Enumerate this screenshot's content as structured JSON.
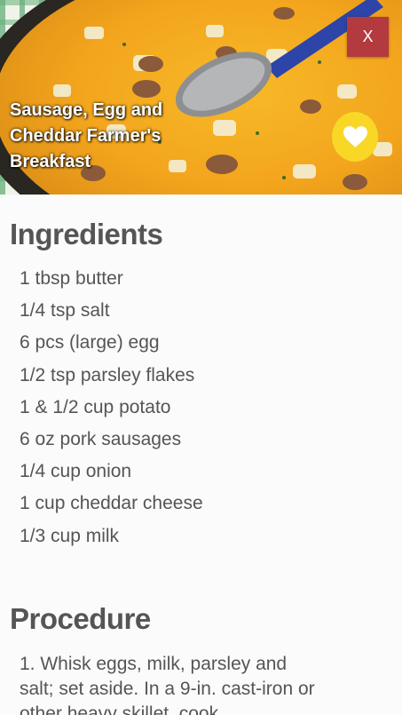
{
  "header": {
    "title": "Sausage, Egg and Cheddar Farmer's Breakfast",
    "close_label": "X",
    "close_color": "#b33a3e",
    "favorite_color": "#f9d726"
  },
  "ingredients": {
    "heading": "Ingredients",
    "items": [
      "1 tbsp butter",
      "1/4 tsp salt",
      "6 pcs (large) egg",
      "1/2 tsp parsley flakes",
      "1 & 1/2 cup potato",
      "6 oz pork sausages",
      "1/4 cup onion",
      "1 cup cheddar cheese",
      "1/3 cup milk"
    ]
  },
  "procedure": {
    "heading": "Procedure",
    "text": "1. Whisk eggs, milk, parsley and salt; set aside. In a 9-in. cast-iron or other heavy skillet, cook"
  }
}
